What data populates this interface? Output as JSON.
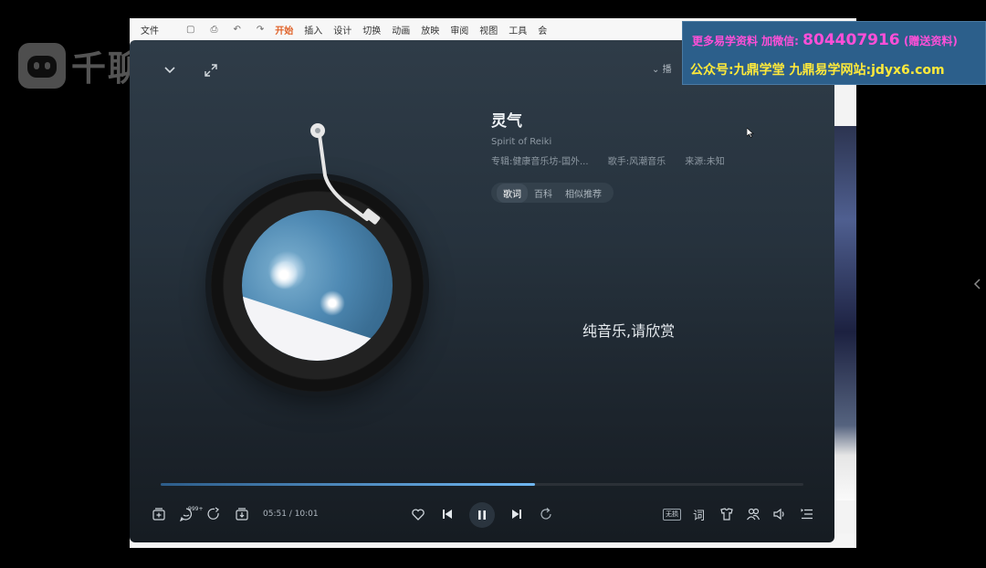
{
  "watermark": {
    "text": "千聊"
  },
  "host": {
    "menu": {
      "file": "文件",
      "items": [
        "开始",
        "插入",
        "设计",
        "切换",
        "动画",
        "放映",
        "审阅",
        "视图",
        "工具",
        "会"
      ]
    }
  },
  "ad": {
    "line1_prefix": "更多易学资料 加微信:",
    "line1_number": "804407916",
    "line1_suffix": "(赠送资料)",
    "line2": "公众号:九鼎学堂 九鼎易学网站:jdyx6.com"
  },
  "player": {
    "topright_label": "播",
    "song": {
      "title": "灵气",
      "subtitle": "Spirit of Reiki",
      "album": "专辑:健康音乐坊-国外...",
      "artist": "歌手:风潮音乐",
      "source": "来源:未知"
    },
    "tabs": [
      {
        "label": "歌词",
        "active": true
      },
      {
        "label": "百科",
        "active": false
      },
      {
        "label": "相似推荐",
        "active": false
      }
    ],
    "lyric": "纯音乐,请欣赏",
    "progress": {
      "fraction": 0.583
    },
    "time": "05:51 / 10:01",
    "comment_badge": "999+",
    "quality": "无损",
    "lyrics_button": "词",
    "icons": {
      "collapse": "chevron-down-icon",
      "fullscreen": "expand-icon",
      "add_to_playlist": "add-icon",
      "comment": "comment-icon",
      "share": "share-icon",
      "download": "download-icon",
      "like": "heart-icon",
      "previous": "skip-back-icon",
      "pause": "pause-icon",
      "next": "skip-forward-icon",
      "repeat": "repeat-icon",
      "effects": "effects-icon",
      "listen_together": "users-icon",
      "volume": "volume-icon",
      "playlist": "queue-icon"
    },
    "colors": {
      "progress_start": "#2d5d8a",
      "progress_end": "#6fb6f0",
      "background": "#26323d"
    }
  }
}
